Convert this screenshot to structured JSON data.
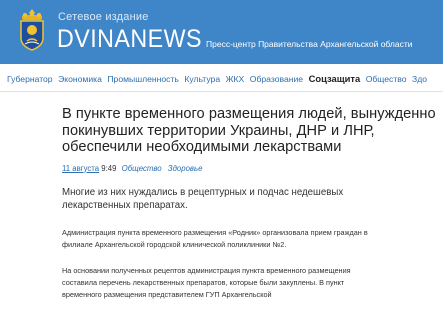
{
  "header": {
    "subtitle": "Сетевое издание",
    "title": "DVINANEWS",
    "press_center": "Пресс-центр Правительства Архангельской области",
    "emblem_icon": "coat-of-arms-icon",
    "background_color": "#3f86c9"
  },
  "nav": {
    "items": [
      {
        "label": "Губернатор"
      },
      {
        "label": "Экономика"
      },
      {
        "label": "Промышленность"
      },
      {
        "label": "Культура"
      },
      {
        "label": "ЖКХ"
      },
      {
        "label": "Образование"
      },
      {
        "label": "Соцзащита",
        "active": true
      },
      {
        "label": "Общество"
      },
      {
        "label": "Здо"
      }
    ]
  },
  "article": {
    "title": "В пункте временного размещения людей, вынужденно покинувших территории Украины, ДНР и ЛНР, обеспечили необходимыми лекарствами",
    "date": "11 августа",
    "time": "9:49",
    "tags": [
      "Общество",
      "Здоровье"
    ],
    "lead": "Многие из них нуждались в рецептурных и подчас недешевых лекарственных препаратах.",
    "paragraphs": [
      "Администрация пункта временного размещения «Родник» организовала прием граждан в филиале Архангельской городской клинической поликлиники №2.",
      "На основании полученных рецептов администрация пункта временного размещения составила перечень лекарственных препаратов, которые были закуплены. В пункт временного размещения представителем ГУП Архангельской"
    ]
  }
}
